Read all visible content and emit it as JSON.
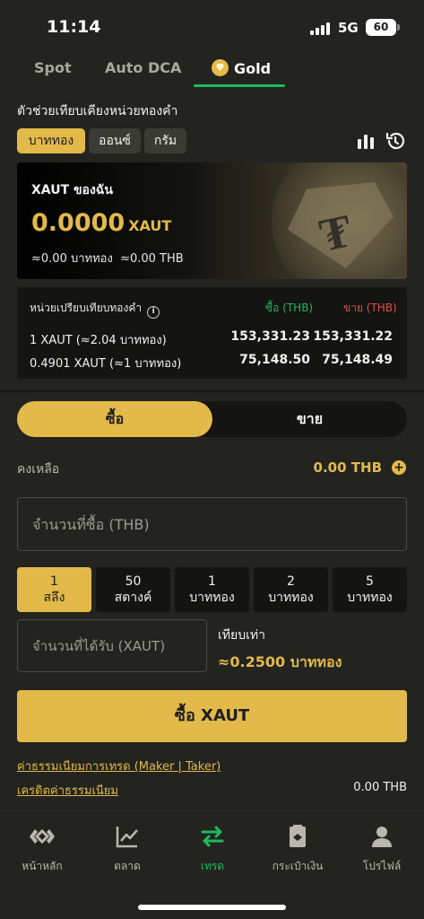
{
  "status": {
    "time": "11:14",
    "network": "5G",
    "battery": "60"
  },
  "tabs": [
    {
      "label": "Spot"
    },
    {
      "label": "Auto DCA"
    },
    {
      "label": "Gold"
    }
  ],
  "helper": {
    "title": "ตัวช่วยเทียบเคียงหน่วยทองคำ",
    "units": [
      "บาททอง",
      "ออนซ์",
      "กรัม"
    ],
    "selected_unit": "บาททอง",
    "icons": [
      "bar-chart-icon",
      "history-icon"
    ]
  },
  "holding": {
    "label": "XAUT ของฉัน",
    "amount": "0.0000",
    "unit": "XAUT",
    "conversion": "≈0.00 บาททอง  ≈0.00 THB"
  },
  "comparison": {
    "header": "หน่วยเปรียบเทียบทองคำ",
    "buy_header": "ซื้อ (THB)",
    "sell_header": "ขาย (THB)",
    "rows": [
      {
        "label": "1 XAUT (≈2.04 บาททอง)",
        "buy": "153,331.23",
        "sell": "153,331.22"
      },
      {
        "label": "0.4901 XAUT (≈1 บาททอง)",
        "buy": "75,148.50",
        "sell": "75,148.49"
      }
    ],
    "buy_color": "#20b85d",
    "sell_color": "#e0504a"
  },
  "trade": {
    "buy_label": "ซื้อ",
    "sell_label": "ขาย",
    "balance_label": "คงเหลือ",
    "balance_value": "0.00 THB",
    "amount_placeholder": "จำนวนที่ซื้อ (THB)",
    "presets": [
      {
        "top": "1",
        "bottom": "สลึง"
      },
      {
        "top": "50",
        "bottom": "สตางค์"
      },
      {
        "top": "1",
        "bottom": "บาททอง"
      },
      {
        "top": "2",
        "bottom": "บาททอง"
      },
      {
        "top": "5",
        "bottom": "บาททอง"
      }
    ],
    "receive_placeholder": "จำนวนที่ได้รับ (XAUT)",
    "equivalent_label": "เทียบเท่า",
    "equivalent_value": "≈0.2500 บาททอง",
    "submit_label": "ซื้อ XAUT",
    "fee_link": "ค่าธรรมเนียมการเทรด (Maker | Taker)",
    "fee_credit_link": "เครดิตค่าธรรมเนียม",
    "fee_credit_value": "0.00 THB"
  },
  "nav": [
    {
      "label": "หน้าหลัก",
      "icon": "home-logo-icon"
    },
    {
      "label": "ตลาด",
      "icon": "market-chart-icon"
    },
    {
      "label": "เทรด",
      "icon": "trade-arrows-icon"
    },
    {
      "label": "กระเป๋าเงิน",
      "icon": "wallet-icon"
    },
    {
      "label": "โปรไฟล์",
      "icon": "profile-icon"
    }
  ],
  "colors": {
    "gold": "#e3b94a",
    "green": "#20b85d",
    "background": "#23241f"
  }
}
